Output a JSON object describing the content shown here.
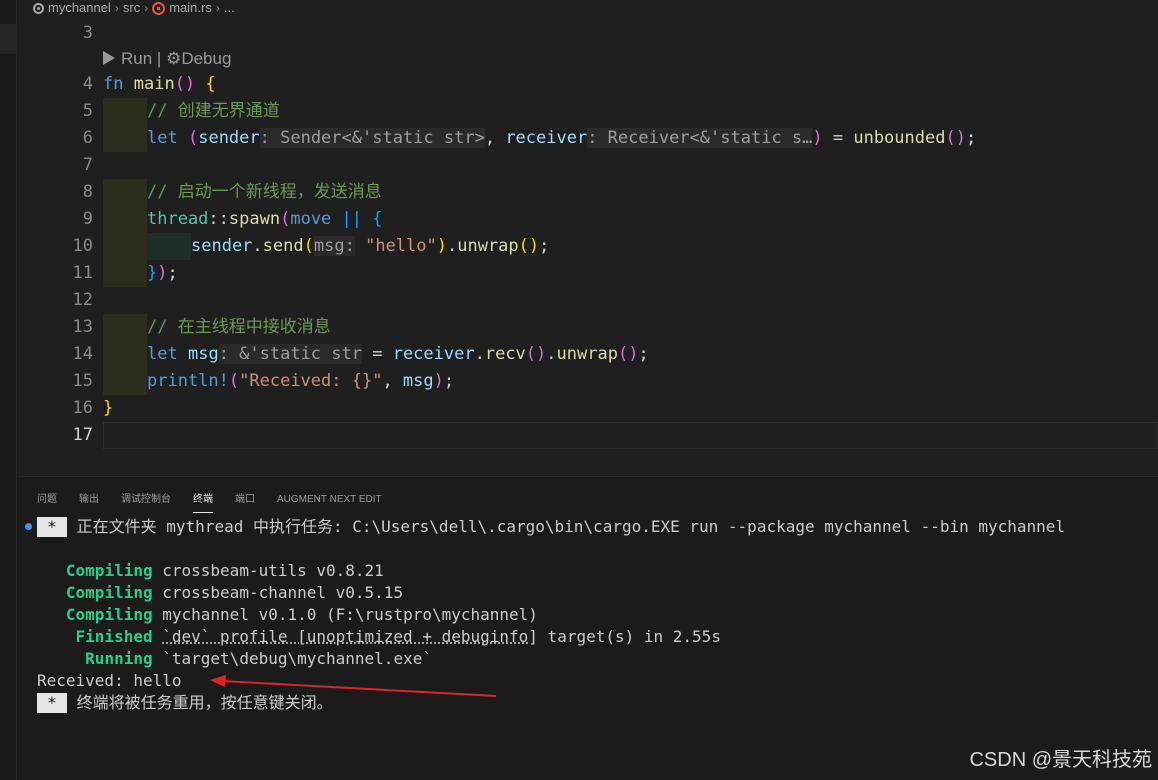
{
  "breadcrumb": {
    "folder": "mychannel",
    "src": "src",
    "file": "main.rs",
    "more": "..."
  },
  "editor": {
    "codelens": {
      "run": "Run",
      "divider": "|",
      "debug": "Debug"
    },
    "line_numbers": [
      "3",
      "4",
      "5",
      "6",
      "7",
      "8",
      "9",
      "10",
      "11",
      "12",
      "13",
      "14",
      "15",
      "16",
      "17"
    ],
    "lines": {
      "l4": {
        "kw": "fn",
        "name": "main",
        "parens": "()",
        "brace": "{"
      },
      "l5": {
        "comment": "// 创建无界通道"
      },
      "l6": {
        "let": "let",
        "open": "(",
        "sender": "sender",
        "sender_hint": ": Sender<&'static str>",
        "comma": ",",
        "receiver": "receiver",
        "receiver_hint": ": Receiver<&'static s…",
        "close": ")",
        "eq": " = ",
        "call": "unbounded",
        "call_parens": "()",
        "semi": ";"
      },
      "l8": {
        "comment": "// 启动一个新线程，发送消息"
      },
      "l9": {
        "thread": "thread",
        "sep": "::",
        "spawn": "spawn",
        "open": "(",
        "move": "move",
        "pipes": "||",
        "brace": "{"
      },
      "l10": {
        "sender": "sender",
        "dot": ".",
        "send": "send",
        "open": "(",
        "hint": "msg:",
        "str": "\"hello\"",
        "close": ")",
        "dot2": ".",
        "unwrap": "unwrap",
        "parens": "()",
        "semi": ";"
      },
      "l11": {
        "brace": "}",
        "paren": ")",
        "semi": ";"
      },
      "l13": {
        "comment": "// 在主线程中接收消息"
      },
      "l14": {
        "let": "let",
        "msg": "msg",
        "hint": ": &'static str",
        "eq": " = ",
        "receiver": "receiver",
        "dot": ".",
        "recv": "recv",
        "parens": "()",
        "dot2": ".",
        "unwrap": "unwrap",
        "parens2": "()",
        "semi": ";"
      },
      "l15": {
        "macro": "println!",
        "open": "(",
        "str": "\"Received: {}\"",
        "comma": ", ",
        "msg": "msg",
        "close": ")",
        "semi": ";"
      },
      "l16": {
        "brace": "}"
      }
    }
  },
  "panel": {
    "tabs": [
      "问题",
      "输出",
      "调试控制台",
      "终端",
      "端口",
      "AUGMENT NEXT EDIT"
    ],
    "active_tab": "终端",
    "terminal": {
      "star": "*",
      "task_line": "正在文件夹 mythread 中执行任务: C:\\Users\\dell\\.cargo\\bin\\cargo.EXE run --package mychannel --bin mychannel",
      "compile": [
        {
          "status": "Compiling",
          "text": "crossbeam-utils v0.8.21"
        },
        {
          "status": "Compiling",
          "text": "crossbeam-channel v0.5.15"
        },
        {
          "status": "Compiling",
          "text": "mychannel v0.1.0 (F:\\rustpro\\mychannel)"
        }
      ],
      "finished_status": "Finished",
      "finished_profile": "`dev` profile [unoptimized + debuginfo]",
      "finished_rest": " target(s) in 2.55s",
      "running_status": "Running",
      "running_text": "`target\\debug\\mychannel.exe`",
      "output": "Received: hello",
      "reuse_line": "终端将被任务重用，按任意键关闭。"
    }
  },
  "watermark": "CSDN @景天科技苑",
  "colors": {
    "arrow": "#e0242a",
    "background": "#1f1f1f",
    "green_status": "#23d18b"
  }
}
